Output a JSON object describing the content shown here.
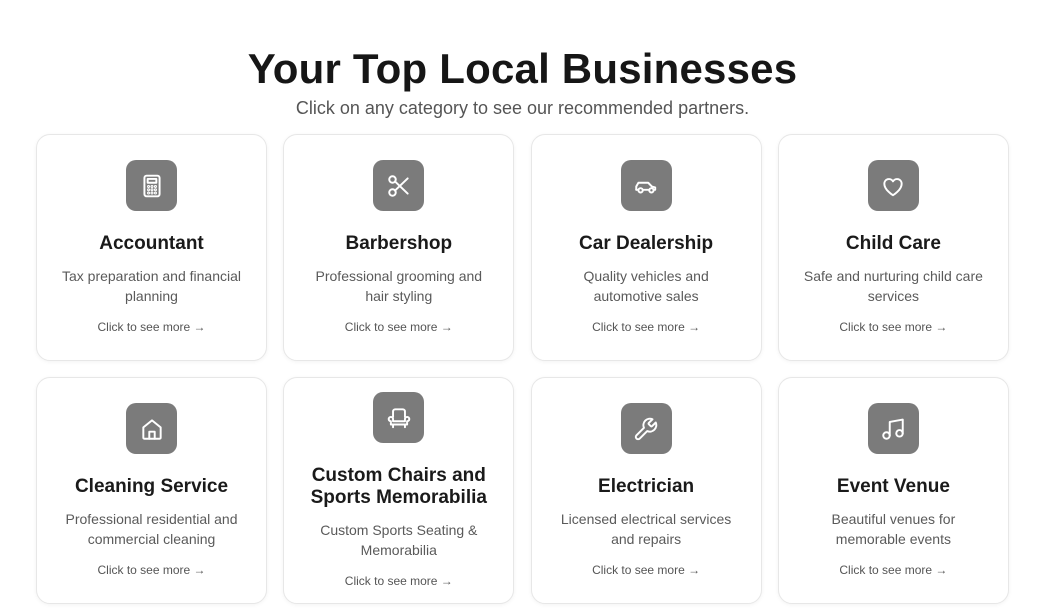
{
  "header": {
    "title": "Your Top Local Businesses",
    "subtitle": "Click on any category to see our recommended partners."
  },
  "categories": [
    {
      "title": "Accountant",
      "description": "Tax preparation and financial planning",
      "link": "Click to see more →",
      "icon": "calculator-icon"
    },
    {
      "title": "Barbershop",
      "description": "Professional grooming and hair styling",
      "link": "Click to see more →",
      "icon": "scissors-icon"
    },
    {
      "title": "Car Dealership",
      "description": "Quality vehicles and automotive sales",
      "link": "Click to see more →",
      "icon": "car-icon"
    },
    {
      "title": "Child Care",
      "description": "Safe and nurturing child care services",
      "link": "Click to see more →",
      "icon": "heart-icon"
    },
    {
      "title": "Cleaning Service",
      "description": "Professional residential and commercial cleaning",
      "link": "Click to see more →",
      "icon": "home-icon"
    },
    {
      "title": "Custom Chairs and Sports Memorabilia",
      "description": "Custom Sports Seating & Memorabilia",
      "link": "Click to see more →",
      "icon": "armchair-icon"
    },
    {
      "title": "Electrician",
      "description": "Licensed electrical services and repairs",
      "link": "Click to see more →",
      "icon": "wrench-icon"
    },
    {
      "title": "Event Venue",
      "description": "Beautiful venues for memorable events",
      "link": "Click to see more →",
      "icon": "music-icon"
    }
  ],
  "colors": {
    "icon_tile": "#7b7b7b",
    "title_text": "#1a1a1a",
    "muted_text": "#5a5a5a",
    "card_border": "#e7e7e7"
  }
}
